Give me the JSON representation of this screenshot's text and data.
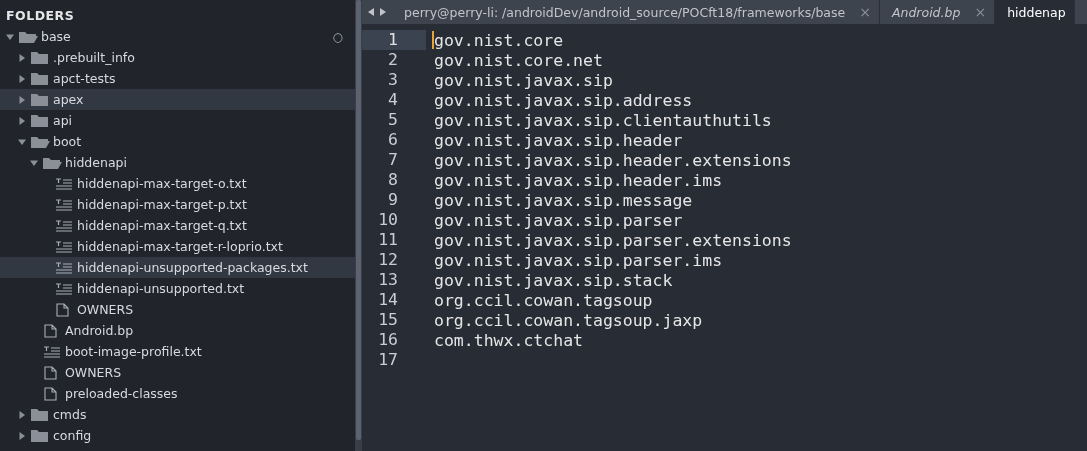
{
  "sidebar": {
    "title": "FOLDERS",
    "tree": [
      {
        "kind": "folder",
        "label": "base",
        "expanded": true,
        "highlighted": false,
        "badge": "○",
        "children": [
          {
            "kind": "folder",
            "label": ".prebuilt_info",
            "expanded": false,
            "highlighted": false
          },
          {
            "kind": "folder",
            "label": "apct-tests",
            "expanded": false,
            "highlighted": false
          },
          {
            "kind": "folder",
            "label": "apex",
            "expanded": false,
            "highlighted": true
          },
          {
            "kind": "folder",
            "label": "api",
            "expanded": false,
            "highlighted": false
          },
          {
            "kind": "folder",
            "label": "boot",
            "expanded": true,
            "highlighted": false,
            "children": [
              {
                "kind": "folder",
                "label": "hiddenapi",
                "expanded": true,
                "highlighted": false,
                "children": [
                  {
                    "kind": "text",
                    "label": "hiddenapi-max-target-o.txt",
                    "highlighted": false
                  },
                  {
                    "kind": "text",
                    "label": "hiddenapi-max-target-p.txt",
                    "highlighted": false
                  },
                  {
                    "kind": "text",
                    "label": "hiddenapi-max-target-q.txt",
                    "highlighted": false
                  },
                  {
                    "kind": "text",
                    "label": "hiddenapi-max-target-r-loprio.txt",
                    "highlighted": false
                  },
                  {
                    "kind": "text",
                    "label": "hiddenapi-unsupported-packages.txt",
                    "highlighted": true
                  },
                  {
                    "kind": "text",
                    "label": "hiddenapi-unsupported.txt",
                    "highlighted": false
                  },
                  {
                    "kind": "file",
                    "label": "OWNERS",
                    "highlighted": false
                  }
                ]
              },
              {
                "kind": "file",
                "label": "Android.bp",
                "highlighted": false
              },
              {
                "kind": "text",
                "label": "boot-image-profile.txt",
                "highlighted": false
              },
              {
                "kind": "file",
                "label": "OWNERS",
                "highlighted": false
              },
              {
                "kind": "file",
                "label": "preloaded-classes",
                "highlighted": false
              }
            ]
          },
          {
            "kind": "folder",
            "label": "cmds",
            "expanded": false,
            "highlighted": false
          },
          {
            "kind": "folder",
            "label": "config",
            "expanded": false,
            "highlighted": false
          }
        ]
      }
    ]
  },
  "tabs": [
    {
      "label": "perry@perry-li: /androidDev/android_source/POCft18/frameworks/base",
      "selected": false,
      "italic": false,
      "close": "×"
    },
    {
      "label": "Android.bp",
      "selected": false,
      "italic": true,
      "close": "×"
    },
    {
      "label": "hiddenap",
      "selected": true,
      "italic": false
    }
  ],
  "editor": {
    "lines": [
      {
        "number": "1",
        "text": "gov.nist.core",
        "current": true
      },
      {
        "number": "2",
        "text": "gov.nist.core.net",
        "current": false
      },
      {
        "number": "3",
        "text": "gov.nist.javax.sip",
        "current": false
      },
      {
        "number": "4",
        "text": "gov.nist.javax.sip.address",
        "current": false
      },
      {
        "number": "5",
        "text": "gov.nist.javax.sip.clientauthutils",
        "current": false
      },
      {
        "number": "6",
        "text": "gov.nist.javax.sip.header",
        "current": false
      },
      {
        "number": "7",
        "text": "gov.nist.javax.sip.header.extensions",
        "current": false
      },
      {
        "number": "8",
        "text": "gov.nist.javax.sip.header.ims",
        "current": false
      },
      {
        "number": "9",
        "text": "gov.nist.javax.sip.message",
        "current": false
      },
      {
        "number": "10",
        "text": "gov.nist.javax.sip.parser",
        "current": false
      },
      {
        "number": "11",
        "text": "gov.nist.javax.sip.parser.extensions",
        "current": false
      },
      {
        "number": "12",
        "text": "gov.nist.javax.sip.parser.ims",
        "current": false
      },
      {
        "number": "13",
        "text": "gov.nist.javax.sip.stack",
        "current": false
      },
      {
        "number": "14",
        "text": "org.ccil.cowan.tagsoup",
        "current": false
      },
      {
        "number": "15",
        "text": "org.ccil.cowan.tagsoup.jaxp",
        "current": false
      },
      {
        "number": "16",
        "text": "com.thwx.ctchat",
        "current": false
      },
      {
        "number": "17",
        "current": false
      }
    ]
  }
}
